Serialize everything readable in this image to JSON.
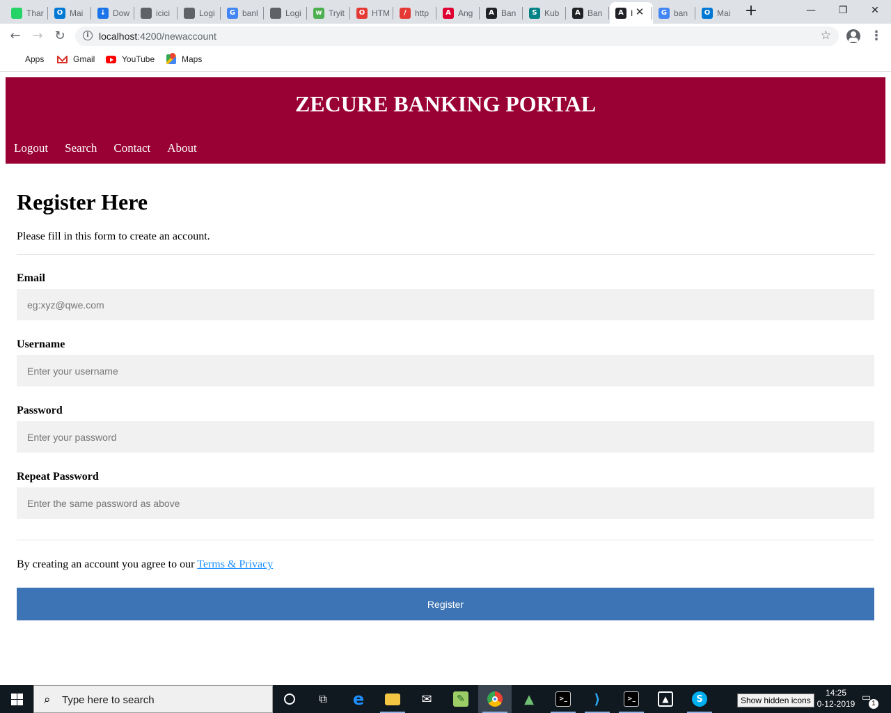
{
  "browser": {
    "tabs": [
      {
        "label": "Thar",
        "icon": "whatsapp-icon",
        "color": "#25d366",
        "glyph": ""
      },
      {
        "label": "Mai",
        "icon": "outlook-icon",
        "color": "#0078d4",
        "glyph": "O"
      },
      {
        "label": "Dow",
        "icon": "download-icon",
        "color": "#1a73e8",
        "glyph": "↓"
      },
      {
        "label": "icici",
        "icon": "globe-icon",
        "color": "#5f6368",
        "glyph": ""
      },
      {
        "label": "Logi",
        "icon": "globe-icon",
        "color": "#5f6368",
        "glyph": ""
      },
      {
        "label": "banl",
        "icon": "google-icon",
        "color": "#4285f4",
        "glyph": "G"
      },
      {
        "label": "Logi",
        "icon": "globe-icon",
        "color": "#5f6368",
        "glyph": ""
      },
      {
        "label": "Tryit",
        "icon": "w3schools-icon",
        "color": "#4caf50",
        "glyph": "w"
      },
      {
        "label": "HTM",
        "icon": "opera-icon",
        "color": "#e53935",
        "glyph": "O"
      },
      {
        "label": "http",
        "icon": "slash-icon",
        "color": "#e53935",
        "glyph": "/"
      },
      {
        "label": "Ang",
        "icon": "angular-icon",
        "color": "#dd0031",
        "glyph": "A"
      },
      {
        "label": "Ban",
        "icon": "angular-icon",
        "color": "#202124",
        "glyph": "A"
      },
      {
        "label": "Kub",
        "icon": "sharepoint-icon",
        "color": "#038387",
        "glyph": "S"
      },
      {
        "label": "Ban",
        "icon": "angular-icon",
        "color": "#202124",
        "glyph": "A"
      },
      {
        "label": "I",
        "icon": "angular-icon",
        "color": "#202124",
        "glyph": "A",
        "active": true
      },
      {
        "label": "ban",
        "icon": "google-icon",
        "color": "#4285f4",
        "glyph": "G"
      },
      {
        "label": "Mai",
        "icon": "outlook-icon",
        "color": "#0078d4",
        "glyph": "O"
      }
    ],
    "url_host": "localhost",
    "url_path": ":4200/newaccount",
    "bookmarks": [
      {
        "label": "Apps",
        "icon": "apps-icon"
      },
      {
        "label": "Gmail",
        "icon": "gmail-icon"
      },
      {
        "label": "YouTube",
        "icon": "youtube-icon"
      },
      {
        "label": "Maps",
        "icon": "maps-icon"
      }
    ]
  },
  "header": {
    "title": "ZECURE BANKING PORTAL",
    "nav": [
      {
        "label": "Logout"
      },
      {
        "label": "Search"
      },
      {
        "label": "Contact"
      },
      {
        "label": "About"
      }
    ],
    "background": "#990033"
  },
  "form": {
    "title": "Register Here",
    "intro": "Please fill in this form to create an account.",
    "fields": [
      {
        "label": "Email",
        "placeholder": "eg:xyz@qwe.com",
        "value": ""
      },
      {
        "label": "Username",
        "placeholder": "Enter your username",
        "value": ""
      },
      {
        "label": "Password",
        "placeholder": "Enter your password",
        "value": ""
      },
      {
        "label": "Repeat Password",
        "placeholder": "Enter the same password as above",
        "value": ""
      }
    ],
    "terms_text": "By creating an account you agree to our ",
    "terms_link": "Terms & Privacy",
    "submit_label": "Register",
    "submit_color": "#3d74b5"
  },
  "taskbar": {
    "search_placeholder": "Type here to search",
    "tooltip": "Show hidden icons",
    "time": "14:25",
    "date": "0-12-2019",
    "notification_count": "1"
  }
}
